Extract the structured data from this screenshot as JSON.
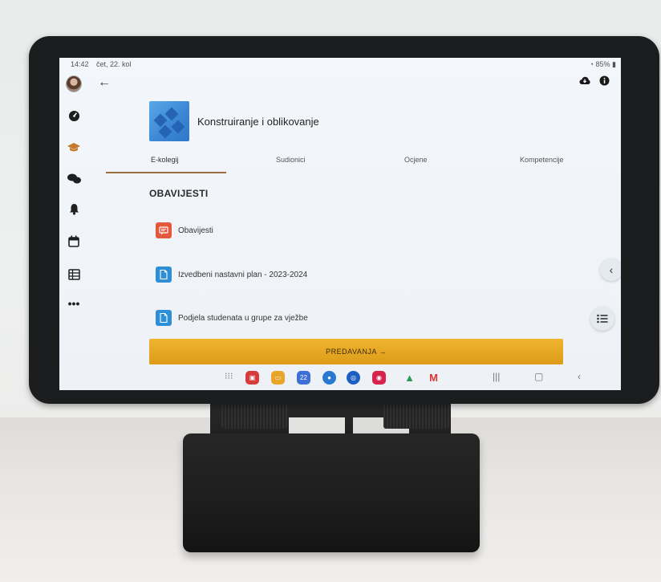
{
  "status": {
    "time": "14:42",
    "date": "čet, 22. kol",
    "battery": "85%"
  },
  "rail": {
    "items": [
      "avatar",
      "dashboard-icon",
      "courses-icon",
      "messages-icon",
      "notifications-icon",
      "calendar-icon",
      "grades-icon",
      "more-icon"
    ]
  },
  "header": {
    "back_icon": "←",
    "download_icon": "cloud-download",
    "info_icon": "info"
  },
  "course": {
    "title": "Konstruiranje i oblikovanje"
  },
  "tabs": [
    "E-kolegij",
    "Sudionici",
    "Ocjene",
    "Kompetencije"
  ],
  "section": {
    "title": "OBAVIJESTI"
  },
  "items": [
    {
      "label": "Obavijesti",
      "icon": "forum-icon",
      "color": "#e4583c"
    },
    {
      "label": "Izvedbeni nastavni plan - 2023-2024",
      "icon": "file-icon",
      "color": "#2f8fd6"
    },
    {
      "label": "Podjela studenata u grupe za vježbe",
      "icon": "file-icon",
      "color": "#2f8fd6"
    }
  ],
  "next_section": {
    "label": "PREDAVANJA →"
  },
  "dock": {
    "calendar_day": "22"
  },
  "colors": {
    "accent": "#9c6d3e",
    "banner": "#e8a824"
  }
}
